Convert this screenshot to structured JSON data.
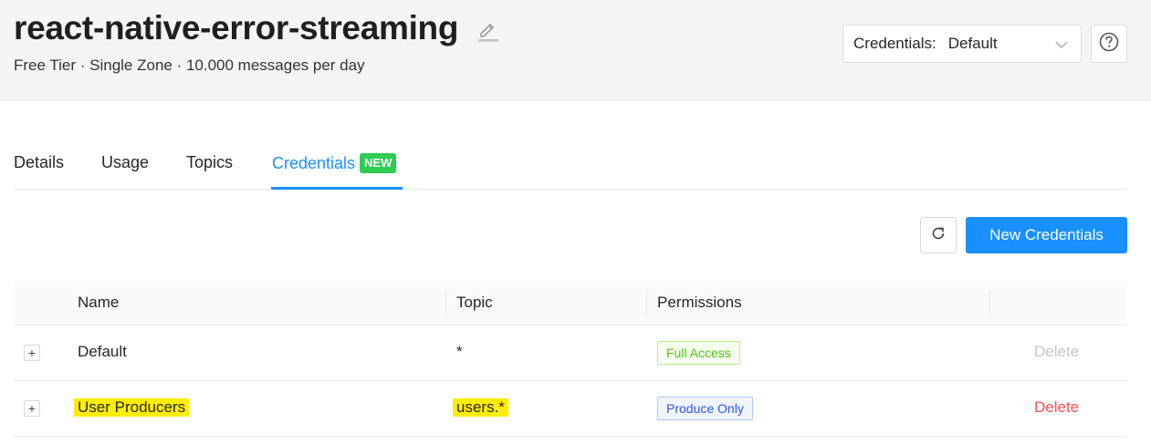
{
  "header": {
    "title": "react-native-error-streaming",
    "subtitle": "Free Tier · Single Zone · 10.000 messages per day",
    "credentials_label": "Credentials:",
    "credentials_value": "Default"
  },
  "tabs": [
    {
      "label": "Details"
    },
    {
      "label": "Usage"
    },
    {
      "label": "Topics"
    },
    {
      "label": "Credentials",
      "badge": "NEW",
      "active": true
    }
  ],
  "toolbar": {
    "new_label": "New Credentials"
  },
  "table": {
    "columns": [
      "Name",
      "Topic",
      "Permissions"
    ],
    "rows": [
      {
        "name": "Default",
        "topic": "*",
        "permission": "Full Access",
        "delete": "Delete",
        "delete_enabled": false
      },
      {
        "name": "User Producers",
        "topic": "users.*",
        "permission": "Produce Only",
        "delete": "Delete",
        "delete_enabled": true
      }
    ]
  },
  "colors": {
    "accent": "#1890ff",
    "badge_new": "#2ecc52",
    "highlight": "#ffee00",
    "danger": "#ff4d4f"
  }
}
